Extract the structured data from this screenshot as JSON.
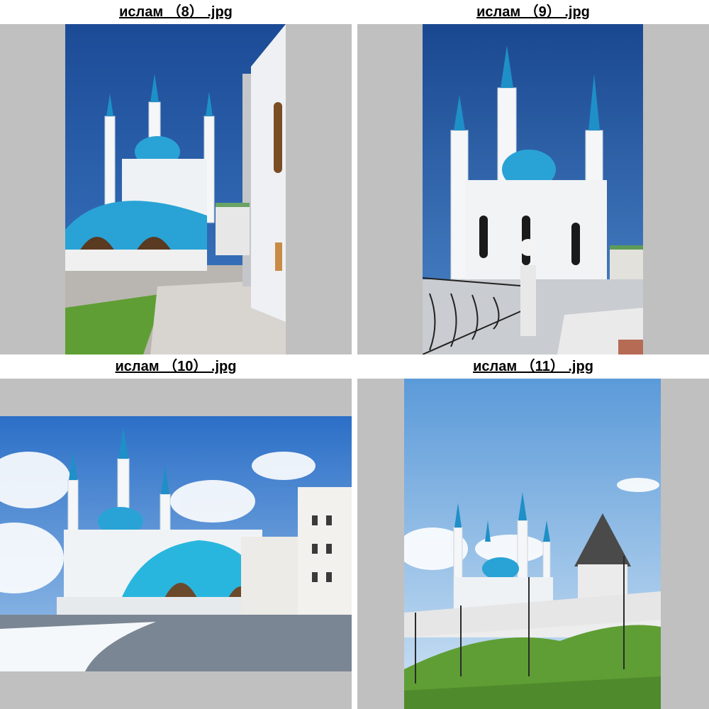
{
  "gallery": {
    "items": [
      {
        "caption": "ислам （8） .jpg",
        "image": "mosque-photo"
      },
      {
        "caption": "ислам （9） .jpg",
        "image": "mosque-photo"
      },
      {
        "caption": "ислам （10） .jpg",
        "image": "mosque-photo"
      },
      {
        "caption": "ислам （11） .jpg",
        "image": "mosque-photo"
      }
    ]
  },
  "colors": {
    "frame_background": "#c0c0c0",
    "dome": "#29a3d6",
    "sky": "#1f4f9a",
    "walls": "#f2f4f6",
    "grass": "#5f9e34"
  }
}
